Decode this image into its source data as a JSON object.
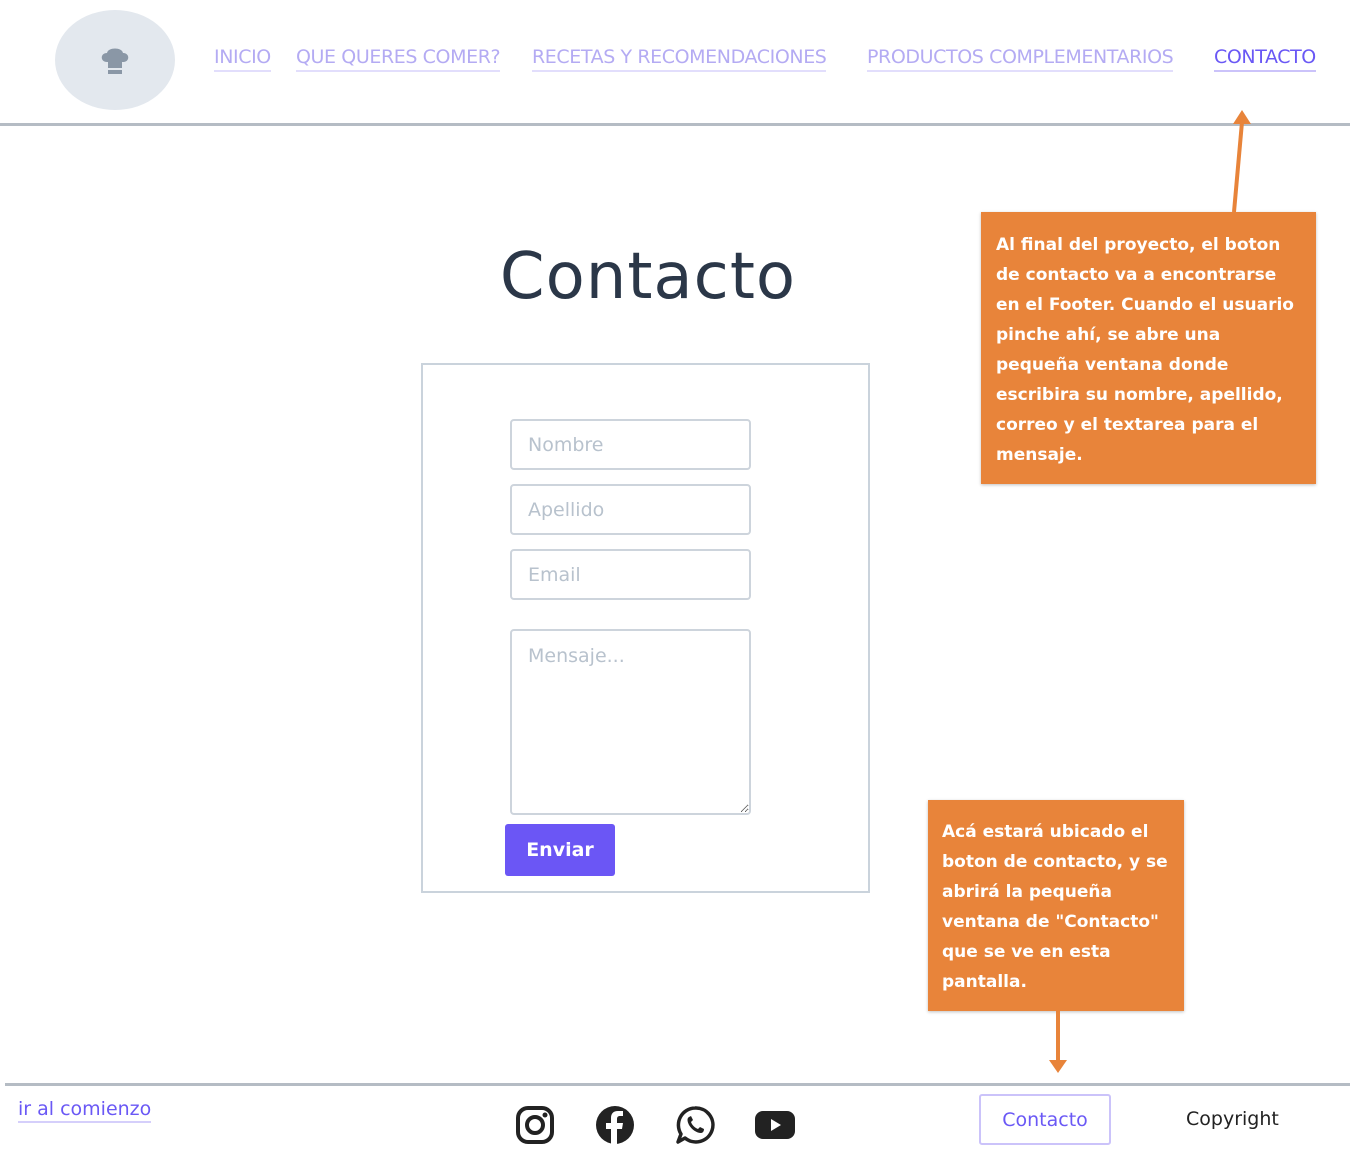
{
  "header": {
    "logo_icon": "chef-hat-icon",
    "nav": [
      {
        "label": "INICIO",
        "active": false
      },
      {
        "label": "QUE QUERES COMER?",
        "active": false
      },
      {
        "label": "RECETAS Y RECOMENDACIONES",
        "active": false
      },
      {
        "label": "PRODUCTOS COMPLEMENTARIOS",
        "active": false
      },
      {
        "label": "CONTACTO",
        "active": true
      }
    ]
  },
  "main": {
    "title": "Contacto",
    "form": {
      "nombre_placeholder": "Nombre",
      "apellido_placeholder": "Apellido",
      "email_placeholder": "Email",
      "mensaje_placeholder": "Mensaje...",
      "submit_label": "Enviar"
    }
  },
  "annotations": {
    "note_1": "Al final del proyecto, el boton de contacto va a encontrarse en el Footer. Cuando el usuario pinche ahí, se abre una pequeña ventana donde escribira su nombre, apellido, correo y el textarea para el mensaje.",
    "note_2": "Acá estará ubicado el boton de contacto, y se abrirá la pequeña ventana de \"Contacto\" que se ve en esta pantalla."
  },
  "footer": {
    "back_to_top": "ir al comienzo",
    "social_icons": [
      "instagram-icon",
      "facebook-icon",
      "whatsapp-icon",
      "youtube-icon"
    ],
    "contact_button": "Contacto",
    "copyright": "Copyright"
  },
  "colors": {
    "accent": "#6b56f5",
    "nav_inactive": "#b4abf3",
    "annotation": "#e8843a",
    "rule": "#b5bcc4"
  }
}
